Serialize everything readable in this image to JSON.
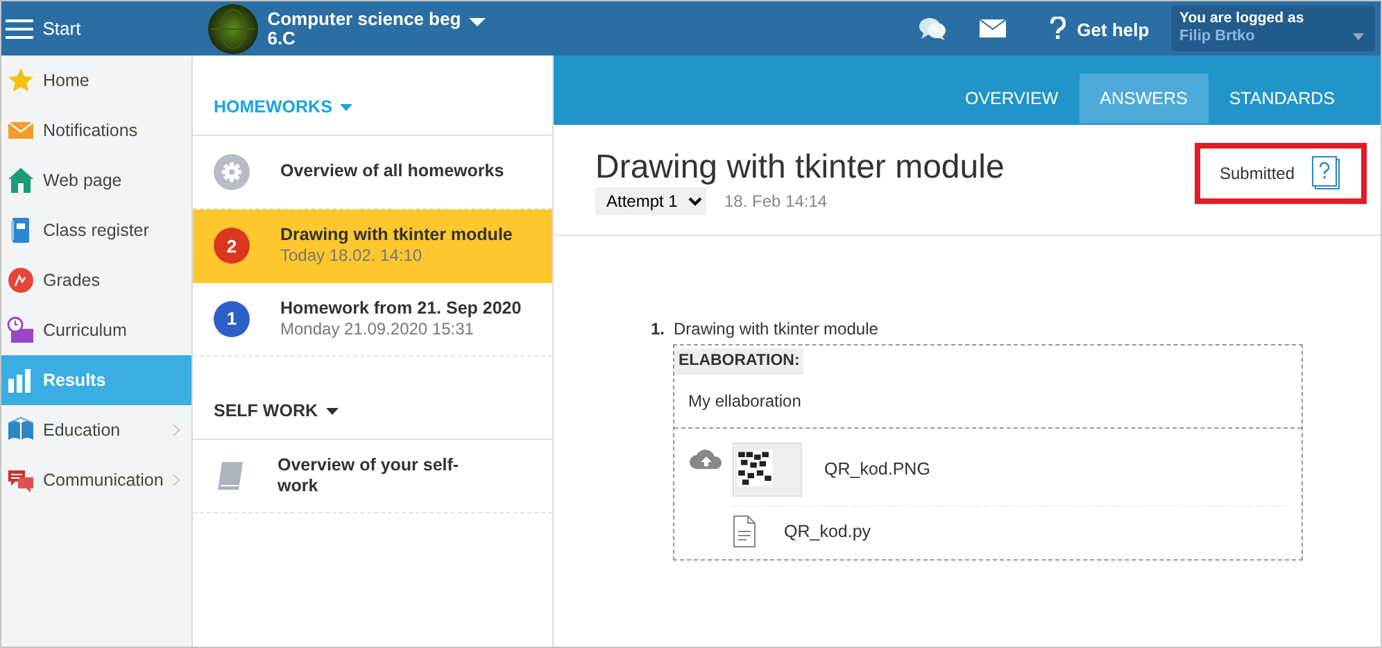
{
  "topbar": {
    "menu_label": "Start",
    "course": {
      "title": "Computer science beg",
      "class": "6.C"
    },
    "help": "Get help",
    "user": {
      "caption": "You are logged as",
      "name": "Filip Brtko"
    }
  },
  "sidebar": {
    "items": [
      {
        "label": "Home",
        "selected": false,
        "expandable": false
      },
      {
        "label": "Notifications",
        "selected": false,
        "expandable": false
      },
      {
        "label": "Web page",
        "selected": false,
        "expandable": false
      },
      {
        "label": "Class register",
        "selected": false,
        "expandable": false
      },
      {
        "label": "Grades",
        "selected": false,
        "expandable": false
      },
      {
        "label": "Curriculum",
        "selected": false,
        "expandable": false
      },
      {
        "label": "Results",
        "selected": true,
        "expandable": false
      },
      {
        "label": "Education",
        "selected": false,
        "expandable": true
      },
      {
        "label": "Communication",
        "selected": false,
        "expandable": true
      }
    ]
  },
  "sections": [
    {
      "title": "HOMEWORKS",
      "selected": true,
      "items": [
        {
          "kind": "overview",
          "title": "Overview of all homeworks",
          "selected": false
        },
        {
          "kind": "numbered",
          "badge": "2",
          "color": "#d9381e",
          "title": "Drawing with tkinter module",
          "date": "Today 18.02. 14:10",
          "selected": true
        },
        {
          "kind": "numbered",
          "badge": "1",
          "color": "#2c5fc7",
          "title": "Homework from 21. Sep 2020",
          "date": "Monday 21.09.2020 15:31",
          "selected": false
        }
      ]
    },
    {
      "title": "SELF WORK",
      "selected": false,
      "items": [
        {
          "kind": "book",
          "title": "Overview of your self-work",
          "selected": false
        }
      ]
    }
  ],
  "tabs": [
    {
      "label": "OVERVIEW",
      "selected": false
    },
    {
      "label": "ANSWERS",
      "selected": true
    },
    {
      "label": "STANDARDS",
      "selected": false
    }
  ],
  "homework": {
    "title": "Drawing with tkinter module",
    "attempt": "Attempt 1",
    "date": "18. Feb 14:14",
    "status": "Submitted",
    "highlighted": true
  },
  "questions": [
    {
      "number": "1.",
      "title": "Drawing with tkinter module",
      "section_label": "ELABORATION:",
      "answer": "My ellaboration",
      "files": [
        {
          "name": "QR_kod.PNG"
        },
        {
          "kind": "document",
          "name": "QR_kod.py"
        }
      ]
    }
  ]
}
